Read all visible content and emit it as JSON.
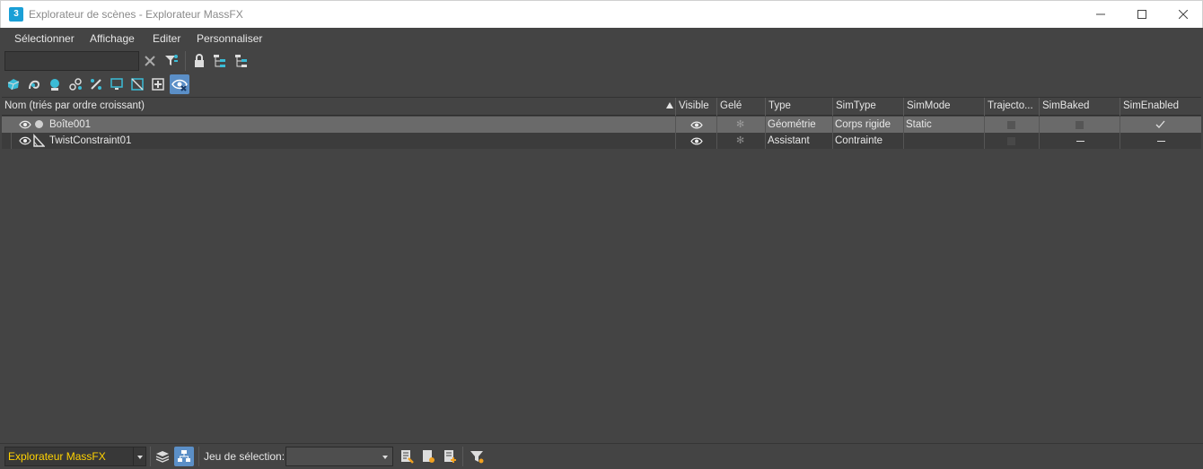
{
  "window": {
    "app_icon_text": "3",
    "title": "Explorateur de scènes - Explorateur MassFX",
    "minimize_icon": "minimize-icon",
    "maximize_icon": "maximize-icon",
    "close_icon": "close-icon"
  },
  "menu": {
    "items": [
      "Sélectionner",
      "Affichage",
      "Editer",
      "Personnaliser"
    ]
  },
  "toolbar": {
    "search_value": "",
    "icons": [
      "clear-x-icon",
      "filter-icon",
      "lock-icon",
      "hierarchy-icon",
      "hierarchy-alt-icon"
    ]
  },
  "filter_toolbar": {
    "icons": [
      "geometry-icon",
      "shape-icon",
      "light-icon",
      "camera-icon",
      "helper-icon",
      "spacewarp-icon",
      "group-icon",
      "xref-icon",
      "hidden-icon"
    ],
    "active": "hidden-icon"
  },
  "table": {
    "columns": [
      "Nom (triés par ordre croissant)",
      "Visible",
      "Gelé",
      "Type",
      "SimType",
      "SimMode",
      "Trajecto...",
      "SimBaked",
      "SimEnabled"
    ],
    "rows": [
      {
        "name": "Boîte001",
        "type": "Géométrie",
        "simtype": "Corps rigide",
        "simmode": "Static",
        "selected": true
      },
      {
        "name": "TwistConstraint01",
        "type": "Assistant",
        "simtype": "Contrainte",
        "simmode": "",
        "selected": false
      }
    ]
  },
  "bottom": {
    "explorer_name": "Explorateur MassFX",
    "selection_set_label": "Jeu de sélection:",
    "selection_set_value": ""
  },
  "colors": {
    "accent": "#5b8fc7",
    "explorer_text": "#ffd200",
    "background": "#444444",
    "selected_row": "#6a6a6a"
  }
}
